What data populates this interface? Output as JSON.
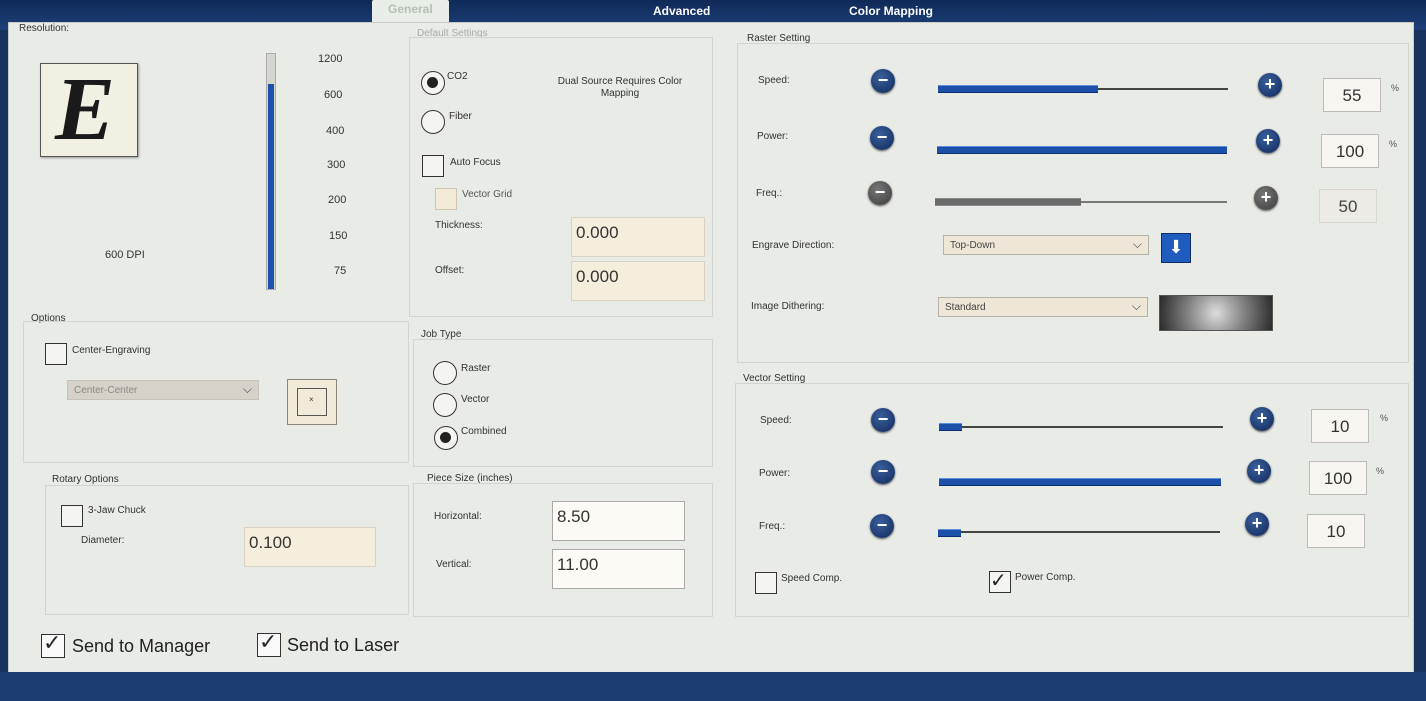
{
  "tabs": [
    {
      "label": "General",
      "active": true
    },
    {
      "label": "Advanced",
      "active": false
    },
    {
      "label": "Color Mapping",
      "active": false
    }
  ],
  "resolution": {
    "title": "Resolution:",
    "preview_letter": "E",
    "dpi_label": "600 DPI",
    "ticks": [
      "1200",
      "600",
      "400",
      "300",
      "200",
      "150",
      "75"
    ],
    "level": 0.88
  },
  "options": {
    "title": "Options",
    "center_engraving": {
      "label": "Center-Engraving",
      "checked": false
    },
    "center_select": "Center-Center"
  },
  "rotary": {
    "title": "Rotary Options",
    "jaw_chuck": {
      "label": "3-Jaw Chuck",
      "checked": false
    },
    "diameter_label": "Diameter:",
    "diameter_value": "0.100"
  },
  "default_settings": {
    "title": "Default Settings",
    "co2": "CO2",
    "fiber": "Fiber",
    "selected": "CO2",
    "dual_source_note": "Dual Source Requires Color Mapping",
    "auto_focus": "Auto Focus",
    "vector_grid": "Vector Grid",
    "thickness_label": "Thickness:",
    "thickness_value": "0.000",
    "offset_label": "Offset:",
    "offset_value": "0.000"
  },
  "job_type": {
    "title": "Job Type",
    "options": [
      "Raster",
      "Vector",
      "Combined"
    ],
    "selected": "Combined"
  },
  "piece_size": {
    "title": "Piece Size (inches)",
    "horizontal_label": "Horizontal:",
    "horizontal_value": "8.50",
    "vertical_label": "Vertical:",
    "vertical_value": "11.00"
  },
  "raster": {
    "title": "Raster Setting",
    "speed": {
      "label": "Speed:",
      "value": "55",
      "fraction": 0.55
    },
    "power": {
      "label": "Power:",
      "value": "100",
      "fraction": 1.0
    },
    "freq": {
      "label": "Freq.:",
      "value": "50",
      "fraction": 0.5,
      "disabled": true
    },
    "engrave_direction_label": "Engrave Direction:",
    "engrave_direction_value": "Top-Down",
    "image_dithering_label": "Image Dithering:",
    "image_dithering_value": "Standard"
  },
  "vector": {
    "title": "Vector Setting",
    "speed": {
      "label": "Speed:",
      "value": "10",
      "fraction": 0.08
    },
    "power": {
      "label": "Power:",
      "value": "100",
      "fraction": 1.0
    },
    "freq": {
      "label": "Freq.:",
      "value": "10",
      "fraction": 0.08
    },
    "speed_comp": {
      "label": "Speed Comp.",
      "checked": false
    },
    "power_comp": {
      "label": "Power Comp.",
      "checked": true
    }
  },
  "percent_sign": "%",
  "send_to_manager": {
    "label": "Send to Manager",
    "checked": true
  },
  "send_to_laser": {
    "label": "Send to Laser",
    "checked": true
  },
  "colors": {
    "accent": "#1d50a8",
    "panel": "#e8ebe6",
    "tabbar": "#17335e"
  }
}
